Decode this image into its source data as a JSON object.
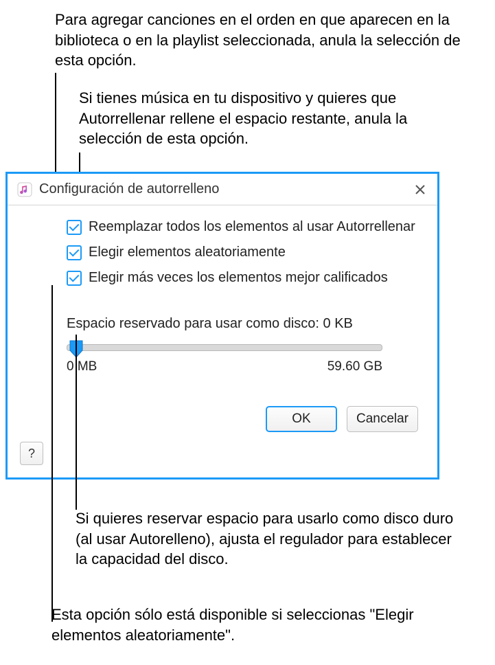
{
  "callouts": {
    "c1": "Para agregar canciones en el orden en que aparecen en la biblioteca o en la playlist seleccionada, anula la selección de esta opción.",
    "c2": "Si tienes música en tu dispositivo y quieres que Autorrellenar rellene el espacio restante, anula la selección de esta opción.",
    "c3": "Si quieres reservar espacio para usarlo como disco duro (al usar Autorelleno), ajusta el regulador para establecer la capacidad del disco.",
    "c4": "Esta opción sólo está disponible si seleccionas \"Elegir elementos aleatoriamente\"."
  },
  "dialog": {
    "title": "Configuración de autorrelleno",
    "checkboxes": {
      "replace_all": "Reemplazar todos los elementos al usar Autorrellenar",
      "choose_random": "Elegir elementos aleatoriamente",
      "higher_rated": "Elegir más veces los elementos mejor calificados"
    },
    "slider": {
      "caption": "Espacio reservado para usar como disco: 0 KB",
      "min_label": "0 MB",
      "max_label": "59.60 GB"
    },
    "buttons": {
      "help": "?",
      "ok": "OK",
      "cancel": "Cancelar"
    }
  }
}
